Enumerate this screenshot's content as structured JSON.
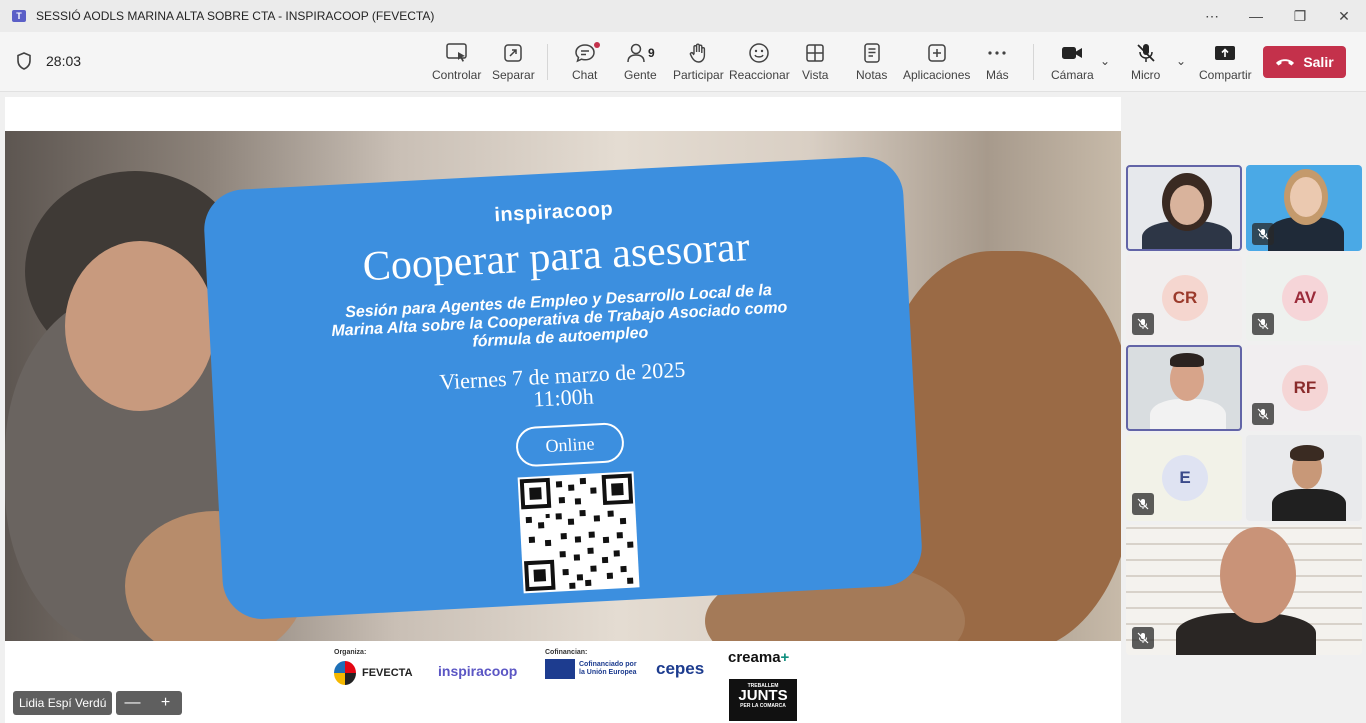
{
  "window": {
    "title": "SESSIÓ AODLS MARINA ALTA SOBRE CTA - INSPIRACOOP (FEVECTA)",
    "app_icon": "T"
  },
  "toolbar": {
    "timer": "28:03",
    "buttons": [
      {
        "label": "Controlar",
        "icon": "share-control-icon"
      },
      {
        "label": "Separar",
        "icon": "pop-out-icon"
      },
      {
        "label": "Chat",
        "icon": "chat-icon"
      },
      {
        "label": "Gente",
        "icon": "people-icon",
        "count": "9"
      },
      {
        "label": "Participar",
        "icon": "raise-hand-icon"
      },
      {
        "label": "Reaccionar",
        "icon": "emoji-icon"
      },
      {
        "label": "Vista",
        "icon": "grid-view-icon"
      },
      {
        "label": "Notas",
        "icon": "notes-icon"
      },
      {
        "label": "Aplicaciones",
        "icon": "apps-icon"
      },
      {
        "label": "Más",
        "icon": "more-icon"
      },
      {
        "label": "Cámara",
        "icon": "camera-icon"
      },
      {
        "label": "Micro",
        "icon": "mic-off-icon"
      },
      {
        "label": "Compartir",
        "icon": "share-screen-icon"
      }
    ],
    "leave_label": "Salir",
    "leave_color": "#c4314b"
  },
  "slide": {
    "brand": "inspiracoop",
    "title": "Cooperar para asesorar",
    "subtitle": "Sesión para Agentes de Empleo y Desarrollo Local de la Marina Alta sobre la Cooperativa de Trabajo Asociado como fórmula de autoempleo",
    "date": "Viernes 7 de marzo de 2025",
    "time": "11:00h",
    "online": "Online",
    "card_color": "#3c8fdf",
    "footer": {
      "organiza": "Organiza:",
      "cofinancian": "Cofinancian:",
      "fevecta": "FEVECTA",
      "inspiracoop": "inspiracoop",
      "eu_line1": "Cofinanciado por",
      "eu_line2": "la Unión Europea",
      "cepes": "cepes",
      "creama": "creama",
      "junts_top": "TREBALLEM",
      "junts_main": "JUNTS",
      "junts_bottom": "PER LA COMARCA"
    }
  },
  "presenter_name": "Lidia Espí Verdú",
  "zoom": {
    "minus": "—",
    "plus": "+"
  },
  "participants": [
    {
      "type": "video",
      "muted": false,
      "active": true
    },
    {
      "type": "video",
      "muted": true,
      "active": false
    },
    {
      "type": "avatar",
      "initials": "CR",
      "muted": true,
      "color": "#f5d6cf",
      "text_color": "#9b3a2b"
    },
    {
      "type": "avatar",
      "initials": "AV",
      "muted": true,
      "color": "#f6d5d8",
      "text_color": "#9b2b3a"
    },
    {
      "type": "video",
      "muted": false,
      "active": true
    },
    {
      "type": "avatar",
      "initials": "RF",
      "muted": true,
      "color": "#f5d5d5",
      "text_color": "#8a2b2b"
    },
    {
      "type": "avatar",
      "initials": "E",
      "muted": true,
      "color": "#dfe3f2",
      "text_color": "#3b4a8a"
    },
    {
      "type": "video",
      "muted": false,
      "active": false
    },
    {
      "type": "video",
      "muted": true,
      "active": false
    }
  ]
}
